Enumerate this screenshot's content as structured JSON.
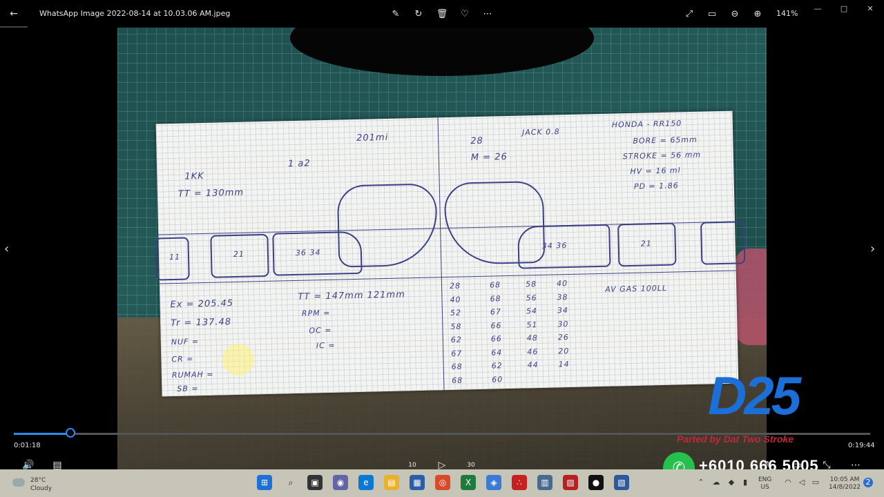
{
  "titlebar": {
    "filename": "WhatsApp Image 2022-08-14 at 10.03.06 AM.jpeg",
    "zoom": "141%",
    "icons": [
      "edit-icon",
      "rotate-icon",
      "delete-icon",
      "heart-icon",
      "more-icon",
      "fullscreen-icon",
      "fit-icon",
      "zoom-out-icon",
      "zoom-in-icon"
    ]
  },
  "paper": {
    "top_left": [
      "1KK",
      "TT = 130mm"
    ],
    "top_mid1": "201mi",
    "top_mid2": "1 a2",
    "top_mid3": "28",
    "top_mid4": "M = 26",
    "jack": "JACK 0.8",
    "spec_title": "HONDA - RR150",
    "spec_lines": [
      "BORE = 65mm",
      "STROKE = 56 mm",
      "HV = 16 ml",
      "PD = 1.86"
    ],
    "boxes": [
      "11",
      "21",
      "36 34",
      "34 36",
      "21"
    ],
    "left_list": [
      "Ex = 205.45",
      "Tr = 137.48",
      "NUF =",
      "CR =",
      "RUMAH =",
      "SB ="
    ],
    "mid_list": [
      "TT = 147mm 121mm",
      "RPM =",
      "OC =",
      "IC ="
    ],
    "table_rows": [
      [
        "28",
        "68",
        "58",
        "40"
      ],
      [
        "40",
        "68",
        "56",
        "38"
      ],
      [
        "52",
        "67",
        "54",
        "34"
      ],
      [
        "58",
        "66",
        "51",
        "30"
      ],
      [
        "62",
        "66",
        "48",
        "26"
      ],
      [
        "67",
        "64",
        "46",
        "20"
      ],
      [
        "68",
        "62",
        "44",
        "14"
      ],
      [
        "68",
        "60",
        "",
        ""
      ]
    ],
    "gas": "AV GAS 100LL"
  },
  "player": {
    "elapsed": "0:01:18",
    "total": "0:19:44",
    "progress_fraction": 0.066,
    "skip_back": "10",
    "skip_fwd": "30"
  },
  "overlay": {
    "logo": "D25",
    "tagline": "Parted by Dat Two Stroke",
    "phone": "+6010 666 5005"
  },
  "taskbar": {
    "temp": "28°C",
    "condition": "Cloudy",
    "lang1": "ENG",
    "lang2": "US",
    "time": "10:05 AM",
    "date": "14/8/2022",
    "notif_count": "2"
  }
}
